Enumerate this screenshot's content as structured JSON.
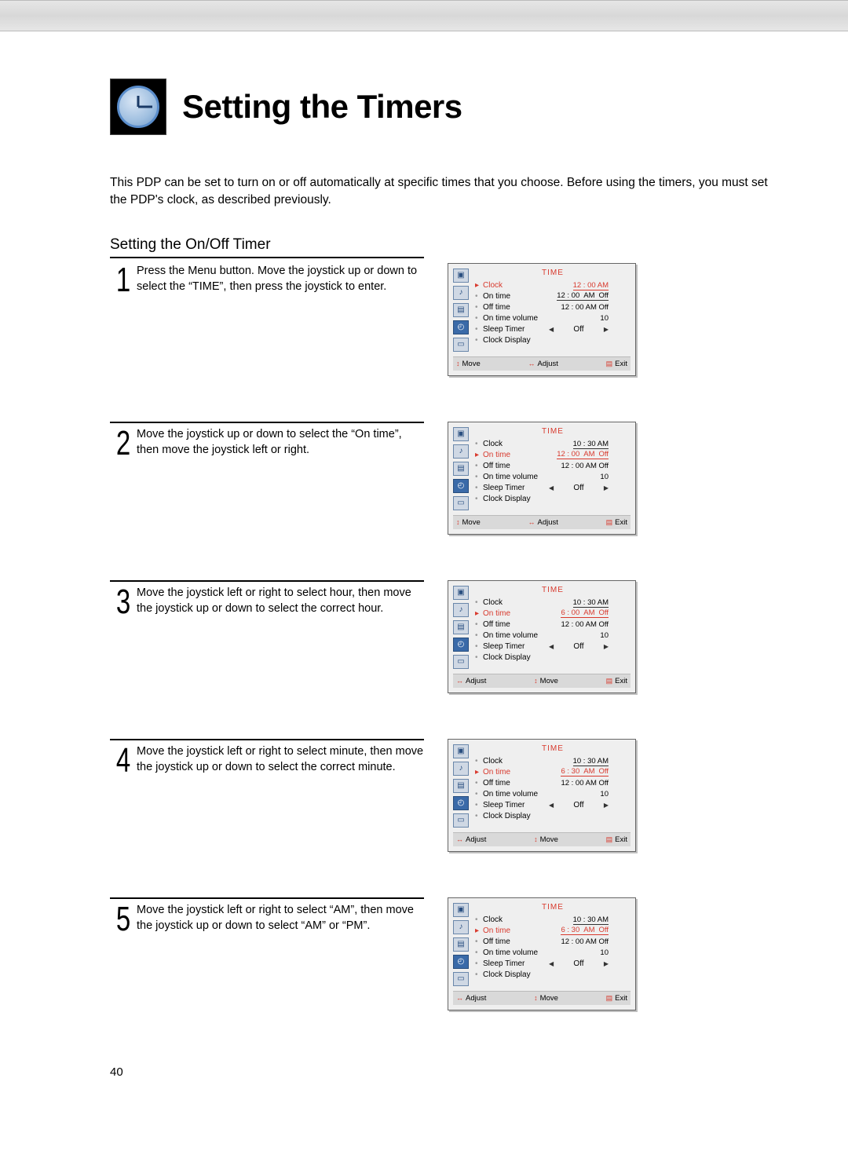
{
  "page": {
    "title": "Setting the Timers",
    "intro": "This PDP can be set to turn on or off automatically at specific times that you choose. Before using the timers, you must set the PDP's clock, as described previously.",
    "section_heading": "Setting the On/Off Timer",
    "page_number": "40"
  },
  "steps": [
    {
      "num": "1",
      "text": "Press the Menu button. Move the joystick up or down to select the “TIME”, then press the joystick to enter."
    },
    {
      "num": "2",
      "text": "Move the joystick up or down to select the “On time”, then move the joystick left or right."
    },
    {
      "num": "3",
      "text": "Move the joystick left or right to select hour, then move the joystick up or down to select the correct hour."
    },
    {
      "num": "4",
      "text": "Move the joystick left or right to select minute, then move the joystick up or down to select the correct minute."
    },
    {
      "num": "5",
      "text": "Move the joystick left or right to select “AM”, then move the joystick up or down to select “AM” or “PM”."
    }
  ],
  "osd_common": {
    "title": "TIME",
    "labels": {
      "clock": "Clock",
      "on_time": "On time",
      "off_time": "Off time",
      "on_time_volume": "On time volume",
      "sleep_timer": "Sleep Timer",
      "clock_display": "Clock Display"
    },
    "foot": {
      "move": "Move",
      "adjust": "Adjust",
      "exit": "Exit"
    },
    "volume": "10",
    "sleep": "Off"
  },
  "osd": [
    {
      "selected": "clock",
      "clock": "12 : 00  AM",
      "on_time_parts": [
        "12 : 00",
        "AM",
        "Off"
      ],
      "off_time": "12 : 00  AM  Off",
      "foot_order": [
        "move",
        "adjust",
        "exit"
      ]
    },
    {
      "selected": "on_time",
      "clock": "10 : 30  AM",
      "on_time_parts": [
        "12 : 00",
        "AM",
        "Off"
      ],
      "off_time": "12 : 00  AM  Off",
      "foot_order": [
        "move",
        "adjust",
        "exit"
      ]
    },
    {
      "selected": "on_time",
      "clock": "10 : 30  AM",
      "on_time_parts": [
        "6 : 00",
        "AM",
        "Off"
      ],
      "highlight_part": 0,
      "off_time": "12 : 00  AM  Off",
      "foot_order": [
        "adjust",
        "move",
        "exit"
      ]
    },
    {
      "selected": "on_time",
      "clock": "10 : 30  AM",
      "on_time_parts": [
        "6 : 30",
        "AM",
        "Off"
      ],
      "highlight_part": 1,
      "off_time": "12 : 00  AM  Off",
      "foot_order": [
        "adjust",
        "move",
        "exit"
      ]
    },
    {
      "selected": "on_time",
      "clock": "10 : 30  AM",
      "on_time_parts": [
        "6 : 30",
        "AM",
        "Off"
      ],
      "highlight_part": 2,
      "off_time": "12 : 00  AM  Off",
      "foot_order": [
        "adjust",
        "move",
        "exit"
      ]
    }
  ]
}
